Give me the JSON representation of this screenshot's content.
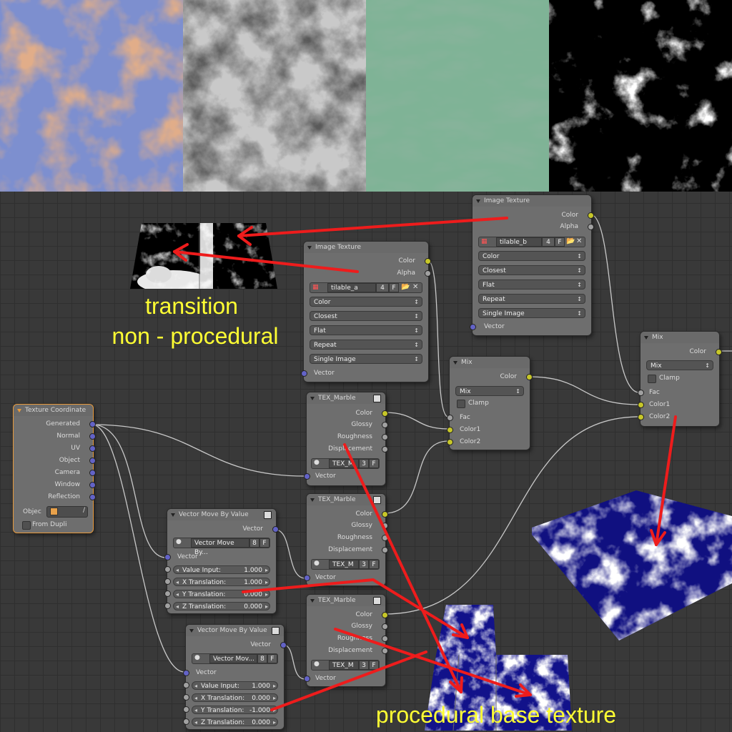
{
  "preview_tiles": [
    {
      "name": "blue-rust-texture-tile"
    },
    {
      "name": "gray-cloud-texture-tile"
    },
    {
      "name": "green-marble-texture-tile"
    },
    {
      "name": "black-cloud-texture-tile"
    }
  ],
  "nodes": {
    "image_texture_b": {
      "title": "Image Texture",
      "outputs": [
        "Color",
        "Alpha"
      ],
      "image_name": "tilable_b",
      "users": "4",
      "fake": "F",
      "color_space": "Color",
      "interpolation": "Closest",
      "projection": "Flat",
      "extension": "Repeat",
      "source": "Single Image",
      "input_vector": "Vector"
    },
    "image_texture_a": {
      "title": "Image Texture",
      "outputs": [
        "Color",
        "Alpha"
      ],
      "image_name": "tilable_a",
      "users": "4",
      "fake": "F",
      "color_space": "Color",
      "interpolation": "Closest",
      "projection": "Flat",
      "extension": "Repeat",
      "source": "Single Image",
      "input_vector": "Vector"
    },
    "mix_1": {
      "title": "Mix",
      "output": "Color",
      "blend_type": "Mix",
      "clamp": "Clamp",
      "inputs": [
        "Fac",
        "Color1",
        "Color2"
      ]
    },
    "mix_2": {
      "title": "Mix",
      "output": "Color",
      "blend_type": "Mix",
      "clamp": "Clamp",
      "inputs": [
        "Fac",
        "Color1",
        "Color2"
      ]
    },
    "texture_coordinate": {
      "title": "Texture Coordinate",
      "outputs": [
        "Generated",
        "Normal",
        "UV",
        "Object",
        "Camera",
        "Window",
        "Reflection"
      ],
      "object_label": "Objec",
      "from_dupli": "From Dupli"
    },
    "tex_marble_1": {
      "title": "TEX_Marble",
      "outputs": [
        "Color",
        "Glossy",
        "Roughness",
        "Displacement"
      ],
      "group_name": "TEX_M",
      "users": "3",
      "fake": "F",
      "input_vector": "Vector"
    },
    "tex_marble_2": {
      "title": "TEX_Marble",
      "outputs": [
        "Color",
        "Glossy",
        "Roughness",
        "Displacement"
      ],
      "group_name": "TEX_M",
      "users": "3",
      "fake": "F",
      "input_vector": "Vector"
    },
    "tex_marble_3": {
      "title": "TEX_Marble",
      "outputs": [
        "Color",
        "Glossy",
        "Roughness",
        "Displacement"
      ],
      "group_name": "TEX_M",
      "users": "3",
      "fake": "F",
      "input_vector": "Vector"
    },
    "vector_move_1": {
      "title": "Vector Move By Value",
      "output": "Vector",
      "group_name": "Vector Move By...",
      "users": "8",
      "fake": "F",
      "input_vector": "Vector",
      "fields": [
        {
          "label": "Value Input:",
          "value": "1.000"
        },
        {
          "label": "X Translation:",
          "value": "1.000"
        },
        {
          "label": "Y Translation:",
          "value": "0.000"
        },
        {
          "label": "Z Translation:",
          "value": "0.000"
        }
      ]
    },
    "vector_move_2": {
      "title": "Vector Move By Value",
      "output": "Vector",
      "group_name": "Vector Mov...",
      "users": "8",
      "fake": "F",
      "input_vector": "Vector",
      "fields": [
        {
          "label": "Value Input:",
          "value": "1.000"
        },
        {
          "label": "X Translation:",
          "value": "0.000"
        },
        {
          "label": "Y Translation:",
          "value": "-1.000"
        },
        {
          "label": "Z Translation:",
          "value": "0.000"
        }
      ]
    }
  },
  "annotations": {
    "transition_line1": "transition",
    "transition_line2": "non - procedural",
    "procedural": "procedural base texture"
  },
  "colors": {
    "annotation_text": "#ffff33",
    "arrow": "#ee1c1c",
    "socket_color": "#c7c729",
    "socket_gray": "#a1a1a1",
    "socket_vector": "#6363c7",
    "node_body": "#6e6e6e",
    "selected_outline": "#e89a3c",
    "canvas": "#393939"
  }
}
